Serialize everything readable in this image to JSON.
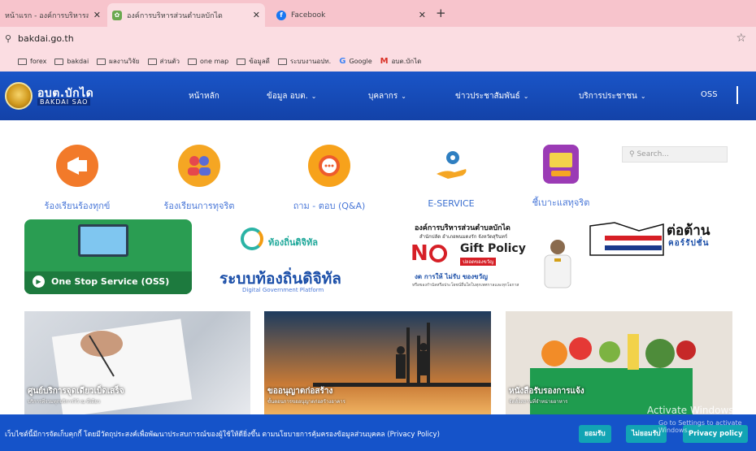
{
  "browser": {
    "tabs": [
      {
        "title": "หน้าแรก - องค์การบริหารส่วนตำบลบักได",
        "close": "✕",
        "active": false
      },
      {
        "title": "องค์การบริหารส่วนตำบลบักได",
        "close": "✕",
        "active": true
      },
      {
        "title": "Facebook",
        "close": "✕",
        "active": false
      }
    ],
    "new_tab": "+",
    "url": "bakdai.go.th",
    "site_icon": "⚲",
    "bookmark_star": "☆",
    "bookmarks": [
      {
        "label": "forex",
        "icon": "folder-icon"
      },
      {
        "label": "bakdai",
        "icon": "folder-icon"
      },
      {
        "label": "ผลงานวิจัย",
        "icon": "folder-icon"
      },
      {
        "label": "ส่วนตัว",
        "icon": "folder-icon"
      },
      {
        "label": "one map",
        "icon": "folder-icon"
      },
      {
        "label": "ข้อมูลดี",
        "icon": "folder-icon"
      },
      {
        "label": "ระบบงานอปท.",
        "icon": "folder-icon"
      },
      {
        "label": "Google",
        "icon": "google-icon"
      },
      {
        "label": "อบต.บักได",
        "icon": "gmail-icon"
      }
    ]
  },
  "site": {
    "logo_title": "อบต.บักได",
    "logo_subtitle": "BAKDAI SAO",
    "nav": [
      {
        "label": "หน้าหลัก",
        "dropdown": false
      },
      {
        "label": "ข้อมูล อบต.",
        "dropdown": true
      },
      {
        "label": "บุคลากร",
        "dropdown": true
      },
      {
        "label": "ข่าวประชาสัมพันธ์",
        "dropdown": true
      },
      {
        "label": "บริการประชาชน",
        "dropdown": true
      },
      {
        "label": "OSS",
        "dropdown": false
      }
    ],
    "chevron": "⌄",
    "search_placeholder": "Search...",
    "search_icon": "⚲",
    "services": [
      {
        "label": "ร้องเรียนร้องทุกข์",
        "icon": "megaphone-icon"
      },
      {
        "label": "ร้องเรียนการทุจริต",
        "icon": "people-icon"
      },
      {
        "label": "ถาม - ตอบ (Q&A)",
        "icon": "chat-icon"
      },
      {
        "label": "E-SERVICE",
        "icon": "gear-hand-icon"
      },
      {
        "label": "ชี้เบาะแสทุจริต",
        "icon": "report-icon"
      }
    ],
    "oss_banner": {
      "label": "One Stop Service (OSS)",
      "play": "▶"
    },
    "local_digital": {
      "brand": "ท้องถิ่นดิจิทัล",
      "title": "ระบบท้องถิ่นดิจิทัล",
      "subtitle": "Digital Government Platform"
    },
    "no_gift": {
      "org": "องค์การบริหารส่วนตำบลบักได",
      "org_sub": "สำนักปลัด อำเภอพนมดงรัก จังหวัดสุรินทร์",
      "no": "N",
      "gift": "Gift Policy",
      "tag": "ปลอดของขวัญ",
      "slogan": "งด การให้ ไม่รับ ของขวัญ",
      "small": "หรือของกำนัลหรือประโยชน์อื่นใดในทุกเทศกาลและทุกโอกาส"
    },
    "anti_corruption": {
      "title": "ต่อต้าน",
      "subtitle": "คอร์รัปชั่น"
    },
    "news": [
      {
        "title": "ศูนย์บริการจุดเดียวเบ็ดเสร็จ",
        "sub": "บริการที่รวมทุกบริการไว้ ณ ที่เดียว"
      },
      {
        "title": "ขออนุญาตก่อสร้าง",
        "sub": "ขั้นตอนการขออนุญาตก่อสร้างอาคาร"
      },
      {
        "title": "หนังสือรับรองการแจ้ง",
        "sub": "จัดตั้งสถานที่จำหน่ายอาหาร"
      }
    ],
    "cookie": {
      "message": "เว็บไซต์นี้มีการจัดเก็บคุกกี้ โดยมีวัตถุประสงค์เพื่อพัฒนาประสบการณ์ของผู้ใช้ให้ดียิ่งขึ้น ตามนโยบายการคุ้มครองข้อมูลส่วนบุคคล (Privacy Policy)",
      "accept": "ยอมรับ",
      "decline": "ไม่ยอมรับ",
      "policy": "Privacy policy"
    },
    "watermark": {
      "line1": "Activate Windows",
      "line2": "Go to Settings to activate Windows."
    }
  }
}
